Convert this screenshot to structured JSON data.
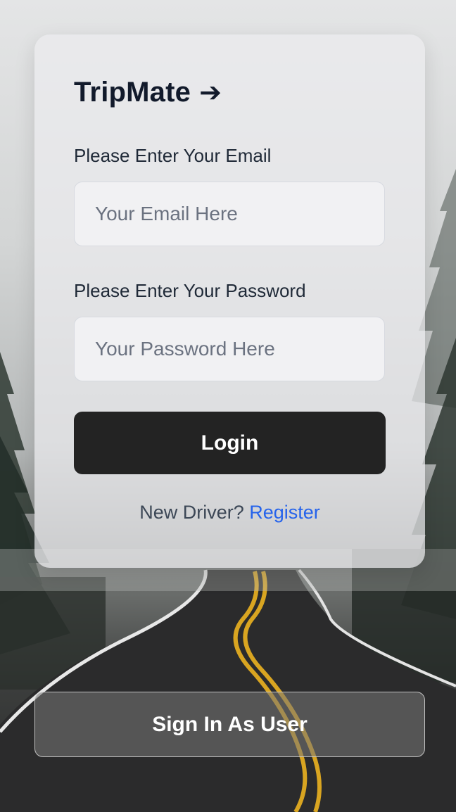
{
  "app": {
    "brand": "TripMate",
    "brand_arrow": "➔"
  },
  "form": {
    "email_label": "Please Enter Your Email",
    "email_placeholder": "Your Email Here",
    "password_label": "Please Enter Your Password",
    "password_placeholder": "Your Password Here",
    "login_label": "Login",
    "register_prompt": "New Driver?",
    "register_link": "Register"
  },
  "footer": {
    "user_signin_label": "Sign In As User"
  },
  "colors": {
    "login_button": "#232323",
    "link": "#2563eb",
    "brand_text": "#121a2b"
  }
}
